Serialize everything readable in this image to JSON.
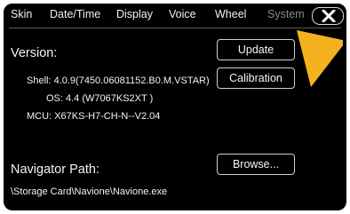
{
  "tabs": [
    {
      "label": "Skin"
    },
    {
      "label": "Date/Time"
    },
    {
      "label": "Display"
    },
    {
      "label": "Voice"
    },
    {
      "label": "Wheel"
    },
    {
      "label": "System",
      "active": true
    }
  ],
  "close_icon": "close-x-icon",
  "version": {
    "heading": "Version:",
    "shell": "Shell: 4.0.9(7450.06081152.B0.M.VSTAR)",
    "os": "OS: 4.4 (W7067KS2XT )",
    "mcu": "MCU: X67KS-H7-CH-N--V2.04"
  },
  "buttons": {
    "update": "Update",
    "calibration": "Calibration",
    "browse": "Browse..."
  },
  "navigator": {
    "heading": "Navigator Path:",
    "path": "\\Storage Card\\Navione\\Navione.exe"
  },
  "colors": {
    "background": "#000000",
    "text": "#f4f4f4",
    "active_tab": "#8c8c8c",
    "pointer_arrow": "#f5b21f"
  },
  "pointer_icon": "pointer-arrow-icon"
}
